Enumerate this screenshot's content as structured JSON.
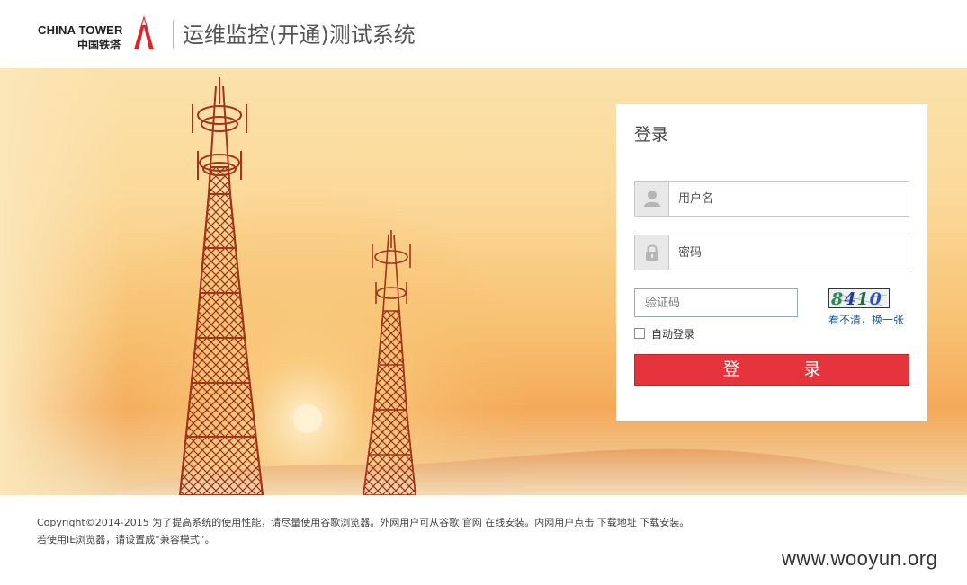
{
  "header": {
    "logo_en": "CHINA TOWER",
    "logo_cn": "中国铁塔",
    "title": "运维监控(开通)测试系统"
  },
  "login": {
    "title": "登录",
    "username_placeholder": "用户名",
    "password_placeholder": "密码",
    "captcha_placeholder": "验证码",
    "captcha_code": "8410",
    "captcha_refresh": "看不清，换一张",
    "auto_login": "自动登录",
    "auto_login_checked": false,
    "submit": "登　录"
  },
  "footer": {
    "line1_prefix": "Copyright©2014-2015  为了提高系统的使用性能，请尽量使用谷歌浏览器。外网用户可从谷歌",
    "official_site": "官网",
    "line1_mid": "在线安装。内网用户点击",
    "download_link": "下载地址",
    "line1_suffix": "下载安装。",
    "line2": "若使用IE浏览器，请设置成“兼容模式”。"
  },
  "watermark": "www.wooyun.org",
  "colors": {
    "brand_red": "#e5343b",
    "link_blue": "#1f5b9a",
    "banner_light": "#fbe2aa",
    "banner_orange": "#f4a95a"
  }
}
